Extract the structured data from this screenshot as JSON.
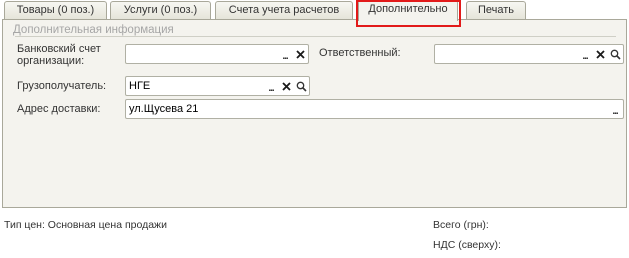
{
  "tabs": [
    {
      "label": "Товары (0 поз.)"
    },
    {
      "label": "Услуги (0 поз.)"
    },
    {
      "label": "Счета учета расчетов"
    },
    {
      "label": "Дополнительно"
    },
    {
      "label": "Печать"
    }
  ],
  "active_tab": "Дополнительно",
  "panel": {
    "group_title": "Дополнительная информация",
    "bank_account_label": "Банковский счет организации:",
    "bank_account_value": "",
    "responsible_label": "Ответственный:",
    "responsible_value": "",
    "consignee_label": "Грузополучатель:",
    "consignee_value": "НГЕ",
    "delivery_address_label": "Адрес доставки:",
    "delivery_address_value": "ул.Щусева 21"
  },
  "buttons": {
    "select": "...",
    "clear": "×",
    "open": "search"
  },
  "footer": {
    "price_type": "Тип цен: Основная цена продажи",
    "total_label": "Всего (грн):",
    "vat_label": "НДС (сверху):"
  },
  "colors": {
    "highlight": "#e21a1a",
    "clear_icon": "#1a1a1a",
    "panel_bg": "#f4f3ee"
  }
}
